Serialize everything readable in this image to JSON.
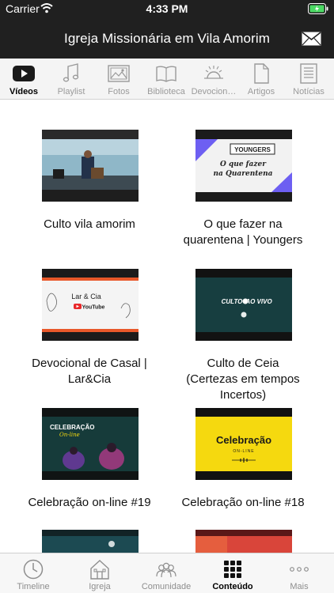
{
  "status_bar": {
    "carrier": "Carrier",
    "time": "4:33 PM"
  },
  "nav": {
    "title": "Igreja Missionária em Vila Amorim"
  },
  "content_tabs": [
    {
      "label": "Vídeos",
      "icon": "play-icon",
      "active": true
    },
    {
      "label": "Playlist",
      "icon": "music-note-icon",
      "active": false
    },
    {
      "label": "Fotos",
      "icon": "photos-icon",
      "active": false
    },
    {
      "label": "Biblioteca",
      "icon": "book-icon",
      "active": false
    },
    {
      "label": "Devocion…",
      "icon": "sun-icon",
      "active": false
    },
    {
      "label": "Artigos",
      "icon": "document-icon",
      "active": false
    },
    {
      "label": "Notícias",
      "icon": "news-icon",
      "active": false
    }
  ],
  "videos": [
    {
      "title": "Culto vila amorim",
      "thumb": "culto"
    },
    {
      "title": "O que fazer na quarentena | Youngers",
      "thumb": "youngers",
      "thumb_text": [
        "YOUNGERS",
        "O que fazer",
        "na Quarentena"
      ]
    },
    {
      "title": "Devocional de Casal | Lar&Cia",
      "thumb": "larcia",
      "thumb_text": [
        "Lar & Cia",
        "YouTube"
      ]
    },
    {
      "title": "Culto de Ceia (Certezas em tempos Incertos)",
      "thumb": "aovivo",
      "thumb_text": [
        "CULTO",
        "AO VIVO"
      ]
    },
    {
      "title": "Celebração on-line #19",
      "thumb": "celebracao-dark",
      "thumb_text": [
        "CELEBRAÇÃO",
        "On-line"
      ]
    },
    {
      "title": "Celebração on-line #18",
      "thumb": "celebracao-yellow",
      "thumb_text": [
        "Celebração",
        "ON-LINE"
      ]
    },
    {
      "title": "",
      "thumb": "partial-teal"
    },
    {
      "title": "",
      "thumb": "partial-red"
    }
  ],
  "bottom_tabs": [
    {
      "label": "Timeline",
      "icon": "clock-icon",
      "active": false
    },
    {
      "label": "Igreja",
      "icon": "church-icon",
      "active": false
    },
    {
      "label": "Comunidade",
      "icon": "people-icon",
      "active": false
    },
    {
      "label": "Conteúdo",
      "icon": "grid-icon",
      "active": true
    },
    {
      "label": "Mais",
      "icon": "more-icon",
      "active": false
    }
  ],
  "colors": {
    "bar_background": "#202020",
    "tab_strip_background": "#f4f4f4",
    "inactive_label": "#9a9a9a",
    "battery_green": "#4cd964",
    "youngers_purple": "#6d5ff2",
    "larcia_orange": "#e8582a",
    "celebracao_yellow": "#f5d90f"
  }
}
